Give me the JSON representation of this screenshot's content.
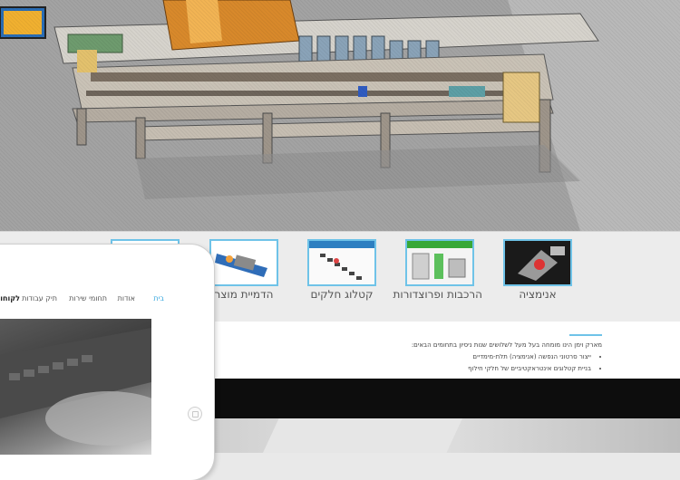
{
  "thumbnails": [
    {
      "label": "אנימציה",
      "icon": "animation-icon"
    },
    {
      "label": "הרכבות ופרוצדורות",
      "icon": "assembly-icon"
    },
    {
      "label": "קטלוג חלקים",
      "icon": "parts-catalog-icon"
    },
    {
      "label": "הדמיית מוצר",
      "icon": "product-simulation-icon"
    },
    {
      "label": "",
      "icon": "document-icon"
    }
  ],
  "content": {
    "intro": "מארק וימן הינו מומחה בעל מעל לשלושים שנות ניסיון בתחומים הבאים:",
    "bullets": [
      "ייצור סרטוני הנפשה (אנימציה) תלת-מימדיים",
      "בניית קטלוגים אינטראקטיביים של חלקי חילוף"
    ]
  },
  "tablet": {
    "nav": [
      "בית",
      "אודות",
      "תחומי שירות",
      "תיק עבודות",
      "לקוחות"
    ]
  },
  "colors": {
    "accent": "#6fc3e8",
    "nav_active": "#3aa8df"
  }
}
